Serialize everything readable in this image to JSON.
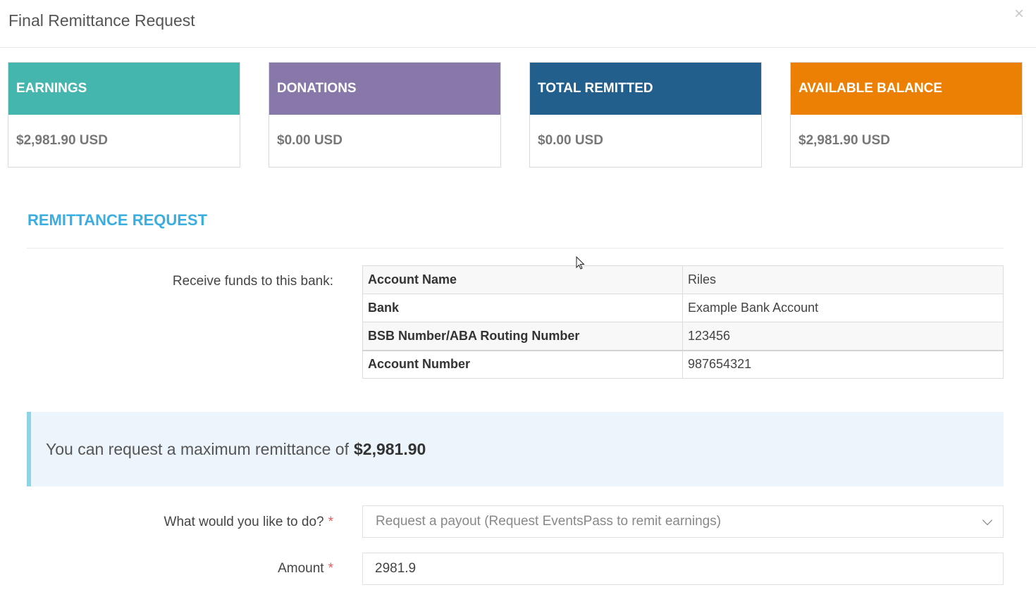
{
  "modal": {
    "title": "Final Remittance Request",
    "close_label": "×"
  },
  "stats": [
    {
      "label": "EARNINGS",
      "value": "$2,981.90 USD",
      "color": "#45b6ae"
    },
    {
      "label": "DONATIONS",
      "value": "$0.00 USD",
      "color": "#8877a9"
    },
    {
      "label": "TOTAL REMITTED",
      "value": "$0.00 USD",
      "color": "#235f8c"
    },
    {
      "label": "AVAILABLE BALANCE",
      "value": "$2,981.90 USD",
      "color": "#ec8005"
    }
  ],
  "section": {
    "title": "REMITTANCE REQUEST"
  },
  "bank": {
    "label": "Receive funds to this bank:",
    "rows": [
      {
        "key": "Account Name",
        "value": "Riles"
      },
      {
        "key": "Bank",
        "value": "Example Bank Account"
      },
      {
        "key": "BSB Number/ABA Routing Number",
        "value": "123456"
      },
      {
        "key": "Account Number",
        "value": "987654321"
      }
    ]
  },
  "info": {
    "text": "You can request a maximum remittance of",
    "amount": "$2,981.90"
  },
  "form": {
    "action_label": "What would you like to do?",
    "action_value": "Request a payout (Request EventsPass to remit earnings)",
    "amount_label": "Amount",
    "amount_value": "2981.9",
    "required_marker": "*"
  }
}
